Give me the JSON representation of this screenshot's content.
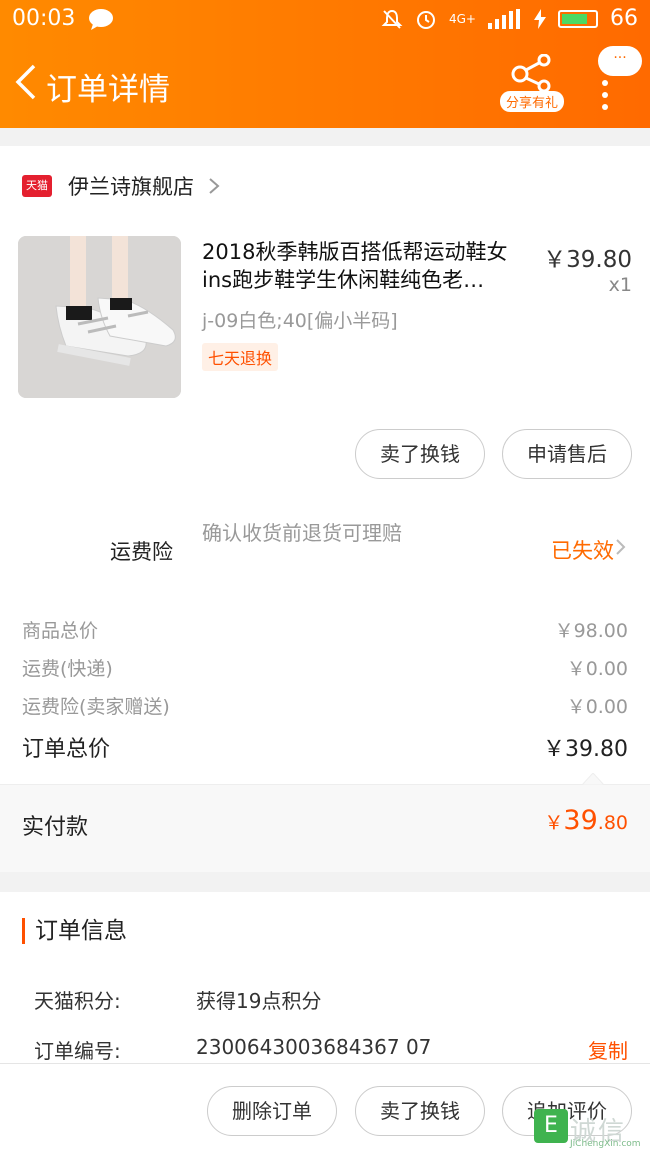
{
  "status_bar": {
    "time": "00:03",
    "network": "4G+",
    "battery": "66"
  },
  "header": {
    "title": "订单详情",
    "share_label": "分享有礼",
    "more_label": "···"
  },
  "store": {
    "badge": "天猫",
    "name": "伊兰诗旗舰店"
  },
  "product": {
    "title": "2018秋季韩版百搭低帮运动鞋女ins跑步鞋学生休闲鞋纯色老…",
    "price": "￥39.80",
    "qty": "x1",
    "sku": "j-09白色;40[偏小半码]",
    "tag": "七天退换"
  },
  "actions": {
    "sell": "卖了换钱",
    "after_sale": "申请售后"
  },
  "insurance": {
    "label": "运费险",
    "desc": "确认收货前退货可理赔",
    "status": "已失效"
  },
  "summary": {
    "goods_label": "商品总价",
    "goods_value": "￥98.00",
    "ship_label": "运费(快递)",
    "ship_value": "￥0.00",
    "ins_label": "运费险(卖家赠送)",
    "ins_value": "￥0.00",
    "total_label": "订单总价",
    "total_value": "￥39.80"
  },
  "paid": {
    "label": "实付款",
    "currency": "￥",
    "int": "39",
    "dec": ".80"
  },
  "order_info": {
    "title": "订单信息",
    "points_label": "天猫积分:",
    "points_value": "获得19点积分",
    "number_label": "订单编号:",
    "number_value": "2300643003684367 07",
    "copy": "复制"
  },
  "bottom": {
    "delete": "删除订单",
    "sell": "卖了换钱",
    "review": "追加评价"
  },
  "watermark": {
    "char": "E",
    "text": "诚信",
    "sub": "JiChengXin.com"
  },
  "colors": {
    "accent": "#ff6a00",
    "price": "#ff5000"
  }
}
